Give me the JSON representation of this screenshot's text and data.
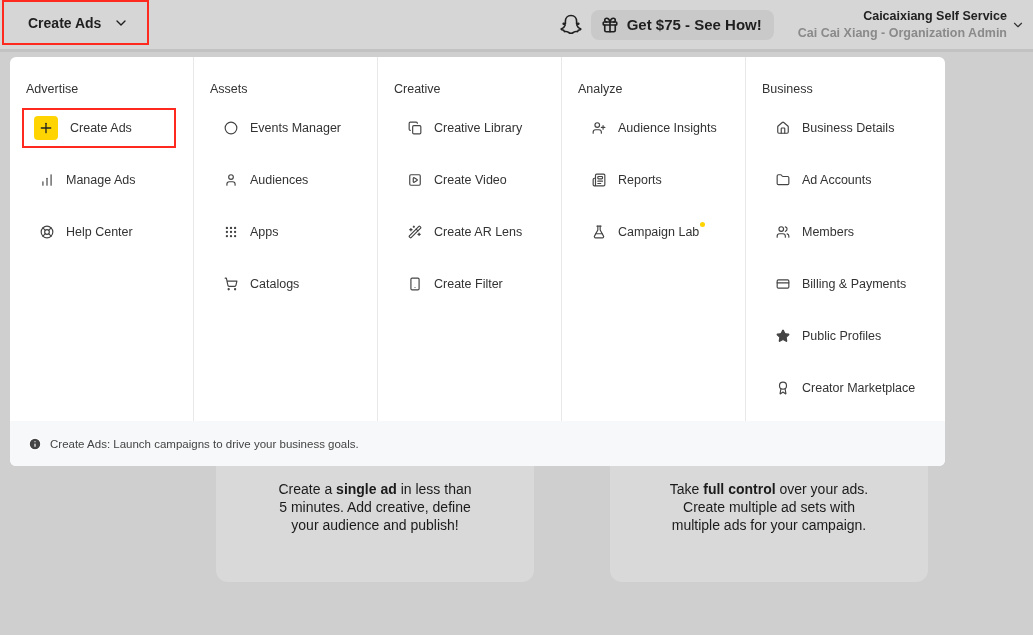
{
  "topbar": {
    "menu_trigger": {
      "label": "Create Ads",
      "outlined": true
    },
    "promo": {
      "label": "Get $75 - See How!"
    },
    "account": {
      "name": "Caicaixiang Self Service",
      "role": "Cai Cai Xiang - Organization Admin"
    }
  },
  "menu": {
    "columns": [
      {
        "title": "Advertise",
        "items": [
          {
            "label": "Create Ads",
            "kind": "primary",
            "outlined": true
          },
          {
            "label": "Manage Ads",
            "kind": "plain",
            "outlined": false
          },
          {
            "label": "Help Center",
            "kind": "plain",
            "outlined": false
          }
        ]
      },
      {
        "title": "Assets",
        "items": [
          {
            "label": "Events Manager",
            "kind": "plain",
            "outlined": false
          },
          {
            "label": "Audiences",
            "kind": "plain",
            "outlined": false
          },
          {
            "label": "Apps",
            "kind": "plain",
            "outlined": false
          },
          {
            "label": "Catalogs",
            "kind": "plain",
            "outlined": false
          }
        ]
      },
      {
        "title": "Creative",
        "items": [
          {
            "label": "Creative Library",
            "kind": "plain",
            "outlined": false
          },
          {
            "label": "Create Video",
            "kind": "plain",
            "outlined": false
          },
          {
            "label": "Create AR Lens",
            "kind": "plain",
            "outlined": false
          },
          {
            "label": "Create Filter",
            "kind": "plain",
            "outlined": false
          }
        ]
      },
      {
        "title": "Analyze",
        "items": [
          {
            "label": "Audience Insights",
            "kind": "plain",
            "outlined": false
          },
          {
            "label": "Reports",
            "kind": "plain",
            "outlined": false
          },
          {
            "label": "Campaign Lab",
            "kind": "plain",
            "outlined": false,
            "new_dot": true
          }
        ]
      },
      {
        "title": "Business",
        "items": [
          {
            "label": "Business Details",
            "kind": "plain",
            "outlined": false
          },
          {
            "label": "Ad Accounts",
            "kind": "plain",
            "outlined": false
          },
          {
            "label": "Members",
            "kind": "plain",
            "outlined": false
          },
          {
            "label": "Billing & Payments",
            "kind": "plain",
            "outlined": false
          },
          {
            "label": "Public Profiles",
            "kind": "plain",
            "outlined": false
          },
          {
            "label": "Creator Marketplace",
            "kind": "plain",
            "outlined": false
          }
        ]
      }
    ],
    "footer": "Create Ads: Launch campaigns to drive your business goals."
  },
  "cards": [
    {
      "text": "Create a **single ad** in less than 5 minutes. Add creative, define your audience and publish!"
    },
    {
      "text": "Take **full control** over your ads. Create multiple ad sets with multiple ads for your campaign."
    }
  ]
}
